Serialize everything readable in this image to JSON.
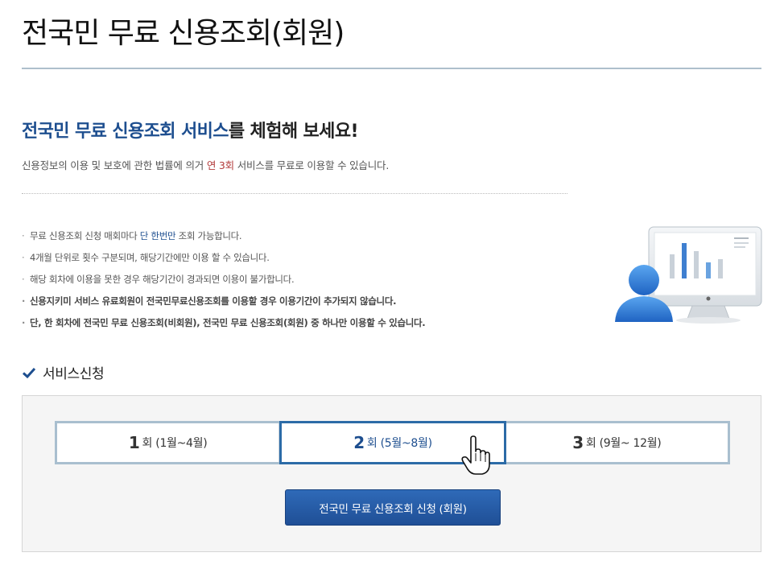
{
  "page": {
    "title": "전국민 무료 신용조회(회원)"
  },
  "intro": {
    "heading_highlight": "전국민 무료 신용조회 서비스",
    "heading_rest": "를 체험해 보세요!",
    "desc_before": "신용정보의 이용 및 보호에 관한 법률에 의거 ",
    "desc_highlight": "연 3회",
    "desc_after": " 서비스를 무료로 이용할 수 있습니다."
  },
  "notices": {
    "item1_before": "무료 신용조회 신청 매회마다 ",
    "item1_highlight": "단 한번만",
    "item1_after": " 조회 가능합니다.",
    "item2": "4개월 단위로 횟수 구분되며, 해당기간에만 이용 할 수 있습니다.",
    "item3": "해당 회차에 이용을 못한 경우 해당기간이 경과되면 이용이 불가합니다.",
    "item4": "신용지키미 서비스 유료회원이 전국민무료신용조회를 이용할 경우 이용기간이 추가되지 않습니다.",
    "item5": "단, 한 회차에 전국민 무료 신용조회(비회원), 전국민 무료 신용조회(회원) 중 하나만 이용할 수 있습니다.",
    "bullet": "·"
  },
  "section": {
    "title": "서비스신청"
  },
  "rounds": [
    {
      "num": "1",
      "unit": "회",
      "period": "(1월~4월)"
    },
    {
      "num": "2",
      "unit": "회",
      "period": "(5월~8월)"
    },
    {
      "num": "3",
      "unit": "회",
      "period": "(9월~ 12월)"
    }
  ],
  "selected_round": "2",
  "apply_button": {
    "label": "전국민 무료 신용조회 신청 (회원)"
  },
  "colors": {
    "accent_blue": "#1d4e8f",
    "highlight_red": "#b23a3a",
    "button_blue": "#2460a8",
    "tab_border": "#a9bfcf"
  },
  "icons": {
    "check": "check-icon",
    "hand": "hand-pointer-icon",
    "illustration": "user-monitor-chart-illustration"
  }
}
